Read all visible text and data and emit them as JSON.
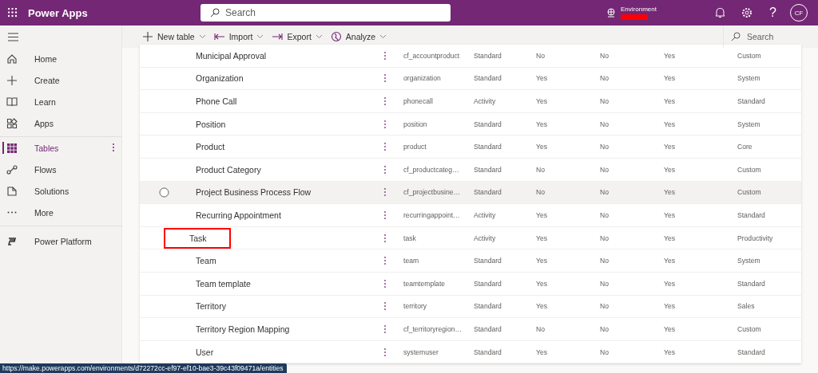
{
  "app": {
    "title": "Power Apps",
    "search_placeholder": "Search",
    "environment_label": "Environment",
    "avatar": "CF",
    "help": "?"
  },
  "sidebar": {
    "groups": [
      [
        {
          "label": "Home",
          "selected": false
        },
        {
          "label": "Create",
          "selected": false
        },
        {
          "label": "Learn",
          "selected": false
        },
        {
          "label": "Apps",
          "selected": false
        }
      ],
      [
        {
          "label": "Tables",
          "selected": true
        },
        {
          "label": "Flows",
          "selected": false
        },
        {
          "label": "Solutions",
          "selected": false
        },
        {
          "label": "More",
          "selected": false
        }
      ],
      [
        {
          "label": "Power Platform",
          "selected": false
        }
      ]
    ]
  },
  "commands": [
    {
      "label": "New table"
    },
    {
      "label": "Import"
    },
    {
      "label": "Export"
    },
    {
      "label": "Analyze"
    }
  ],
  "command_search": {
    "placeholder": "Search"
  },
  "table": {
    "rows": [
      {
        "cells": [
          "Municipal Approval",
          "cf_accountproduct",
          "Standard",
          "No",
          "No",
          "Yes",
          "Custom"
        ],
        "hovered": false,
        "highlighted": false
      },
      {
        "cells": [
          "Organization",
          "organization",
          "Standard",
          "Yes",
          "No",
          "Yes",
          "System"
        ],
        "hovered": false,
        "highlighted": false
      },
      {
        "cells": [
          "Phone Call",
          "phonecall",
          "Activity",
          "Yes",
          "No",
          "Yes",
          "Standard"
        ],
        "hovered": false,
        "highlighted": false
      },
      {
        "cells": [
          "Position",
          "position",
          "Standard",
          "Yes",
          "No",
          "Yes",
          "System"
        ],
        "hovered": false,
        "highlighted": false
      },
      {
        "cells": [
          "Product",
          "product",
          "Standard",
          "Yes",
          "No",
          "Yes",
          "Core"
        ],
        "hovered": false,
        "highlighted": false
      },
      {
        "cells": [
          "Product Category",
          "cf_productcateg…",
          "Standard",
          "No",
          "No",
          "Yes",
          "Custom"
        ],
        "hovered": false,
        "highlighted": false
      },
      {
        "cells": [
          "Project Business Process Flow",
          "cf_projectbusine…",
          "Standard",
          "No",
          "No",
          "Yes",
          "Custom"
        ],
        "hovered": true,
        "highlighted": false
      },
      {
        "cells": [
          "Recurring Appointment",
          "recurringappoint…",
          "Activity",
          "Yes",
          "No",
          "Yes",
          "Standard"
        ],
        "hovered": false,
        "highlighted": false
      },
      {
        "cells": [
          "Task",
          "task",
          "Activity",
          "Yes",
          "No",
          "Yes",
          "Productivity"
        ],
        "hovered": false,
        "highlighted": true
      },
      {
        "cells": [
          "Team",
          "team",
          "Standard",
          "Yes",
          "No",
          "Yes",
          "System"
        ],
        "hovered": false,
        "highlighted": false
      },
      {
        "cells": [
          "Team template",
          "teamtemplate",
          "Standard",
          "Yes",
          "No",
          "Yes",
          "Standard"
        ],
        "hovered": false,
        "highlighted": false
      },
      {
        "cells": [
          "Territory",
          "territory",
          "Standard",
          "Yes",
          "No",
          "Yes",
          "Sales"
        ],
        "hovered": false,
        "highlighted": false
      },
      {
        "cells": [
          "Territory Region Mapping",
          "cf_territoryregion…",
          "Standard",
          "No",
          "No",
          "Yes",
          "Custom"
        ],
        "hovered": false,
        "highlighted": false
      },
      {
        "cells": [
          "User",
          "systemuser",
          "Standard",
          "Yes",
          "No",
          "Yes",
          "Standard"
        ],
        "hovered": false,
        "highlighted": false
      }
    ]
  },
  "status_url": "https://make.powerapps.com/environments/d72272cc-ef97-ef10-bae3-39c43f09471a/entities"
}
